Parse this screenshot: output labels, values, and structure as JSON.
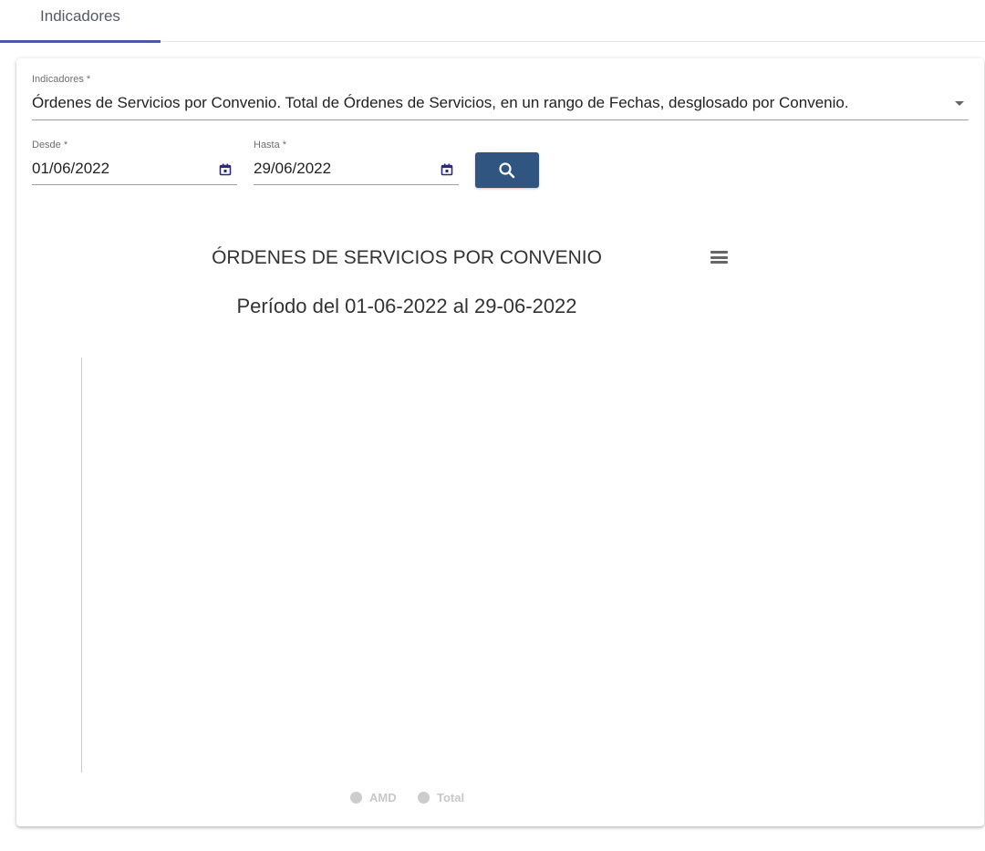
{
  "tabs": [
    {
      "label": "Indicadores",
      "active": true
    }
  ],
  "form": {
    "indicator": {
      "label": "Indicadores *",
      "value": "Órdenes de Servicios por Convenio. Total de Órdenes de Servicios, en un rango de Fechas, desglosado por Convenio."
    },
    "from": {
      "label": "Desde *",
      "value": "01/06/2022"
    },
    "to": {
      "label": "Hasta *",
      "value": "29/06/2022"
    },
    "search_icon": "search-icon"
  },
  "chart_data": {
    "type": "bar",
    "title": "ÓRDENES DE SERVICIOS POR CONVENIO",
    "subtitle": "Período del 01-06-2022 al 29-06-2022",
    "categories": [],
    "series": [
      {
        "name": "AMD",
        "values": []
      },
      {
        "name": "Total",
        "values": []
      }
    ],
    "legend": "bottom-center",
    "grid": false
  },
  "colors": {
    "accent": "#4b5aa6",
    "button": "#2f5580",
    "calendar_icon": "#2c2a7a",
    "legend_disabled": "#cccccc"
  }
}
